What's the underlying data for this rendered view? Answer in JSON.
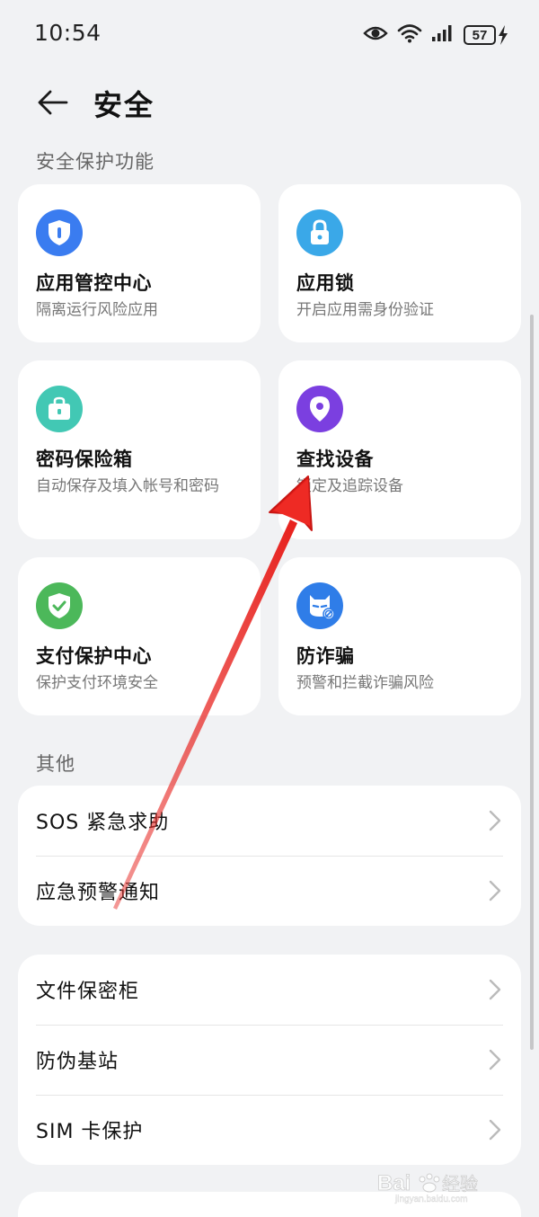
{
  "status_bar": {
    "time": "10:54",
    "battery": "57",
    "icons": [
      "eye-icon",
      "wifi-icon",
      "signal-icon",
      "battery-icon",
      "charging-icon"
    ]
  },
  "header": {
    "title": "安全",
    "back_icon": "arrow-left-icon"
  },
  "sections": {
    "security": "安全保护功能",
    "other": "其他"
  },
  "cards": [
    {
      "title": "应用管控中心",
      "subtitle": "隔离运行风险应用",
      "icon": "shield-icon",
      "color": "#3a7cf0"
    },
    {
      "title": "应用锁",
      "subtitle": "开启应用需身份验证",
      "icon": "padlock-icon",
      "color": "#3aa8e8"
    },
    {
      "title": "密码保险箱",
      "subtitle": "自动保存及填入帐号和密码",
      "icon": "briefcase-lock-icon",
      "color": "#42c8b4"
    },
    {
      "title": "查找设备",
      "subtitle": "锁定及追踪设备",
      "icon": "location-pin-icon",
      "color": "#7b3fe0"
    },
    {
      "title": "支付保护中心",
      "subtitle": "保护支付环境安全",
      "icon": "shield-check-icon",
      "color": "#4cb85a"
    },
    {
      "title": "防诈骗",
      "subtitle": "预警和拦截诈骗风险",
      "icon": "anti-fraud-icon",
      "color": "#2f7de8"
    }
  ],
  "list_group_1": [
    "SOS 紧急求助",
    "应急预警通知"
  ],
  "list_group_2": [
    "文件保密柜",
    "防伪基站",
    "SIM 卡保护"
  ],
  "watermark": {
    "brand": "Bai",
    "brand_suffix": "经验",
    "url": "jingyan.baidu.com"
  }
}
